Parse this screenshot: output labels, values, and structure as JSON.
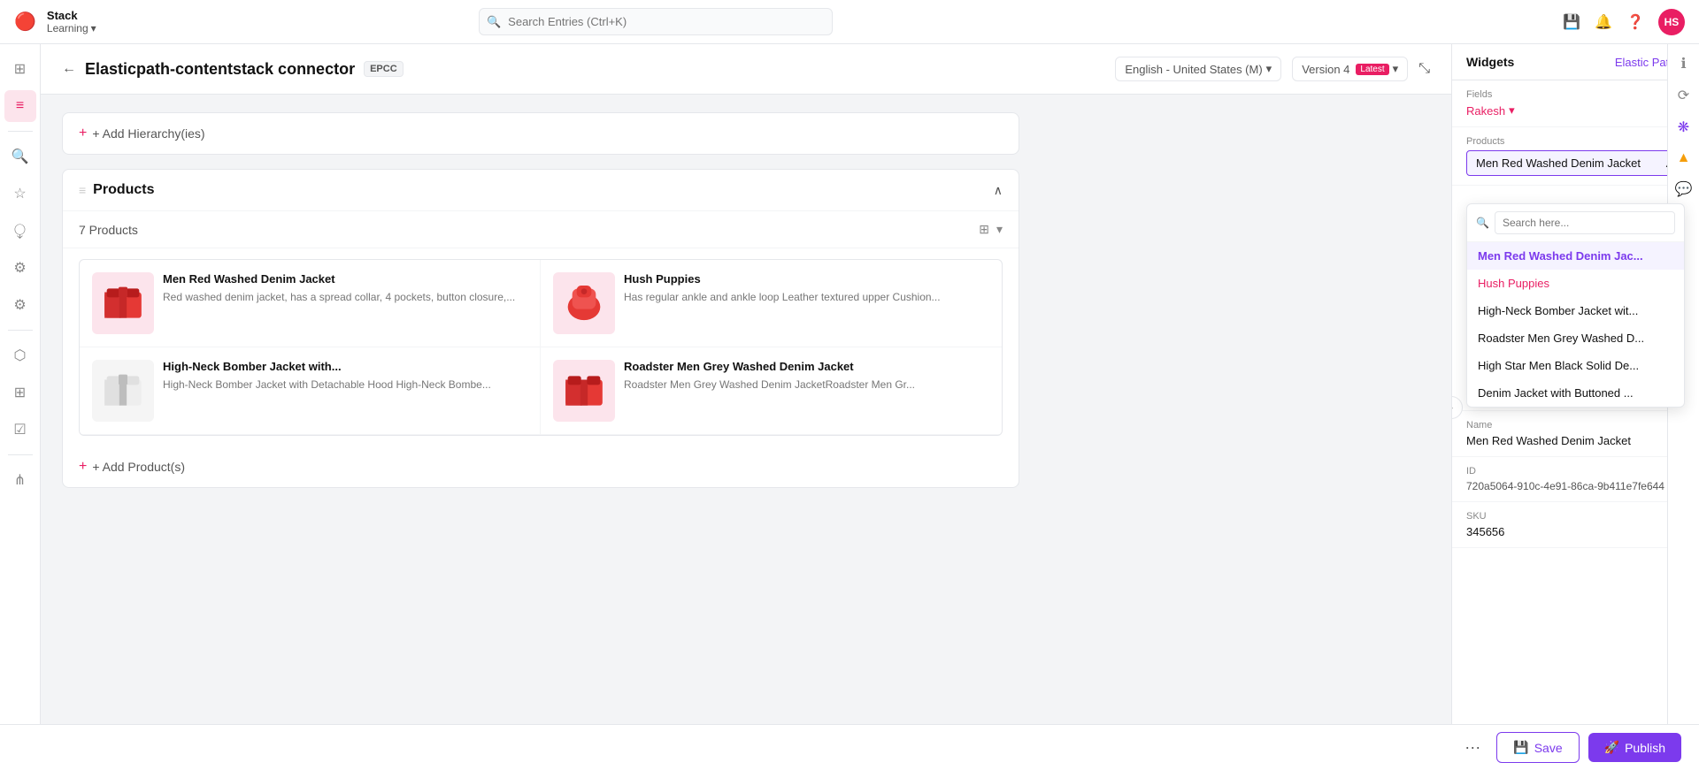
{
  "app": {
    "stack_name": "Stack",
    "stack_env": "Learning",
    "search_placeholder": "Search Entries (Ctrl+K)"
  },
  "nav": {
    "avatar_text": "HS"
  },
  "entry": {
    "title": "Elasticpath-contentstack connector",
    "badge": "EPCC",
    "language": "English - United States (M)",
    "version_label": "Version 4",
    "version_tag": "Latest",
    "back_label": "←"
  },
  "sections": {
    "hierarchy_label": "+ Add Hierarchy(ies)",
    "products_title": "Products",
    "products_count": "7 Products",
    "add_products_label": "+ Add Product(s)"
  },
  "products": [
    {
      "name": "Men Red Washed Denim Jacket",
      "desc": "Red washed denim jacket, has a spread collar, 4 pockets, button closure,..."
    },
    {
      "name": "Hush Puppies",
      "desc": "Has regular ankle and ankle loop Leather textured upper Cushion..."
    },
    {
      "name": "High-Neck Bomber Jacket with...",
      "desc": "High-Neck Bomber Jacket with Detachable Hood High-Neck Bombe..."
    },
    {
      "name": "Roadster Men Grey Washed Denim Jacket",
      "desc": "Roadster Men Grey Washed Denim JacketRoadster Men Gr..."
    }
  ],
  "widgets": {
    "title": "Widgets",
    "brand": "Elastic Path",
    "fields_label": "Fields",
    "fields_value": "Rakesh",
    "products_label": "Products",
    "products_selected": "Men Red Washed Denim Jacket",
    "search_placeholder": "Search here...",
    "dropdown_items": [
      {
        "label": "Men Red Washed Denim Jac...",
        "state": "active"
      },
      {
        "label": "Hush Puppies",
        "state": "selected"
      },
      {
        "label": "High-Neck Bomber Jacket wit...",
        "state": "normal"
      },
      {
        "label": "Roadster Men Grey Washed D...",
        "state": "normal"
      },
      {
        "label": "High Star Men Black Solid De...",
        "state": "normal"
      },
      {
        "label": "Denim Jacket with Buttoned ...",
        "state": "normal"
      }
    ],
    "name_label": "Name",
    "name_value": "Men Red Washed Denim Jacket",
    "id_label": "ID",
    "id_value": "720a5064-910c-4e91-86ca-9b411e7fe644",
    "sku_label": "SKU",
    "sku_value": "345656"
  },
  "bottom_bar": {
    "dots": "···",
    "save_label": "Save",
    "publish_label": "Publish"
  }
}
